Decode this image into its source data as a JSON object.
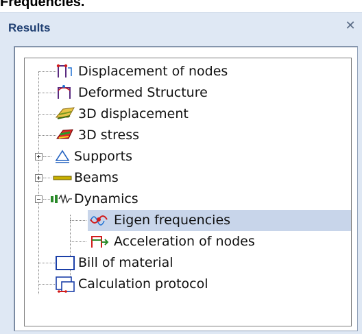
{
  "caption": "Frequencies.",
  "panel": {
    "title": "Results",
    "close_glyph": "✕"
  },
  "tree": {
    "items": [
      {
        "label": "Displacement of nodes",
        "icon": "displacement-nodes-icon"
      },
      {
        "label": "Deformed Structure",
        "icon": "deformed-structure-icon"
      },
      {
        "label": "3D displacement",
        "icon": "3d-displacement-icon"
      },
      {
        "label": "3D stress",
        "icon": "3d-stress-icon"
      },
      {
        "label": "Supports",
        "icon": "supports-icon",
        "expander": "+"
      },
      {
        "label": "Beams",
        "icon": "beams-icon",
        "expander": "+"
      },
      {
        "label": "Dynamics",
        "icon": "dynamics-icon",
        "expander": "-"
      },
      {
        "label": "Eigen frequencies",
        "icon": "eigen-frequencies-icon",
        "selected": true
      },
      {
        "label": "Acceleration of nodes",
        "icon": "acceleration-nodes-icon"
      },
      {
        "label": "Bill of material",
        "icon": "bill-of-material-icon"
      },
      {
        "label": "Calculation protocol",
        "icon": "calculation-protocol-icon"
      }
    ]
  },
  "colors": {
    "panel_bg": "#dfe8f4",
    "title_color": "#1f3f72",
    "selection_bg": "#c8d5ea"
  }
}
